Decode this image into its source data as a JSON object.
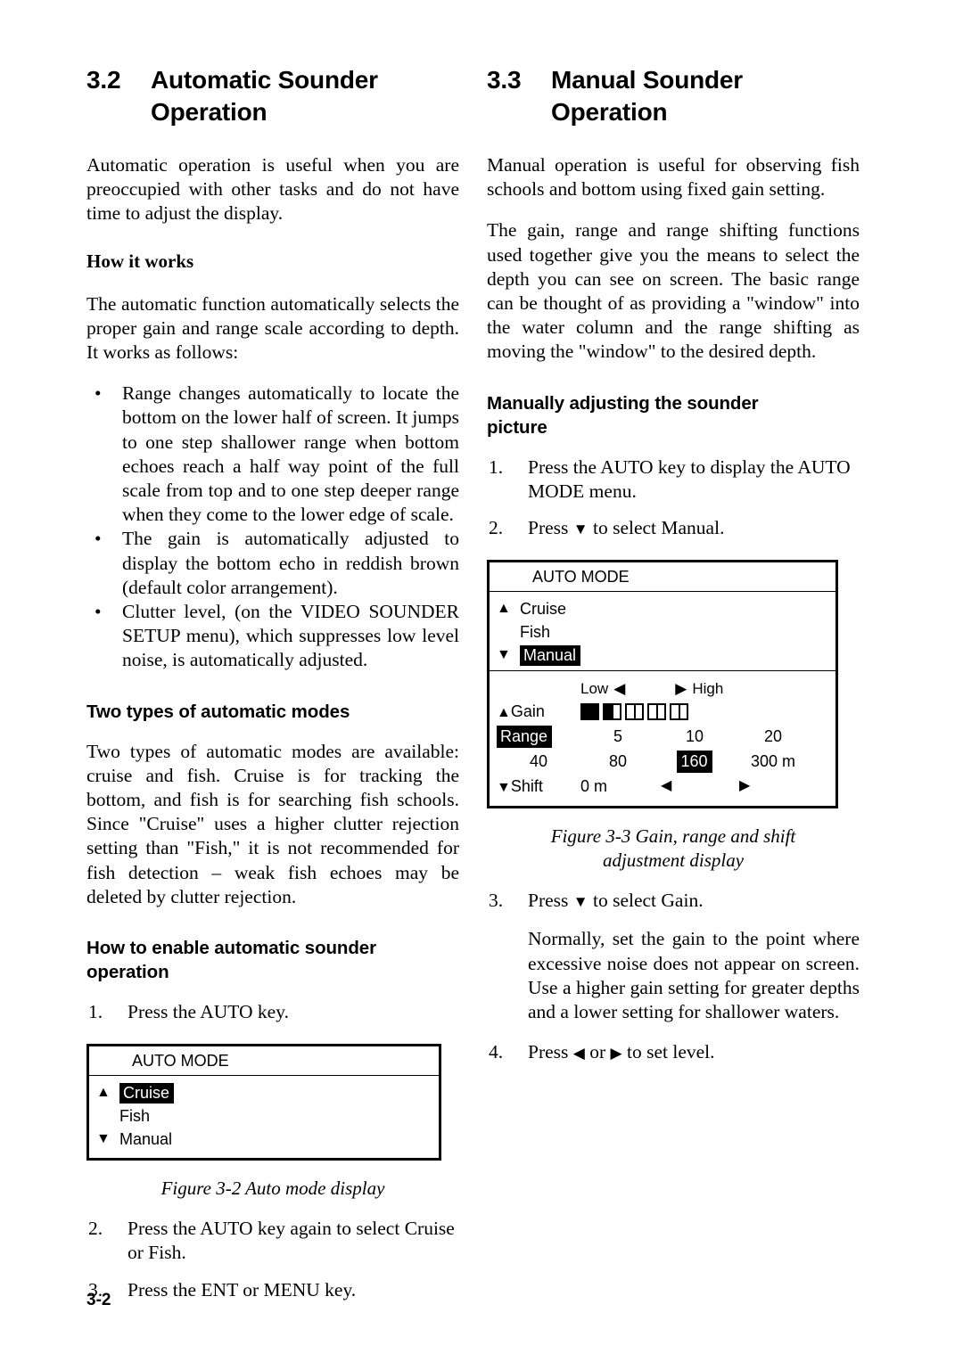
{
  "left_column": {
    "section": {
      "number": "3.2",
      "title_line1": "Automatic Sounder",
      "title_line2": "Operation"
    },
    "intro": "Automatic operation is useful when you are preoccupied with other tasks and do not have time to adjust the display.",
    "how_it_works_heading": "How it works",
    "how_it_works_intro": "The automatic function automatically selects the proper gain and range scale according to depth. It works as follows:",
    "bullets": [
      "Range changes automatically to locate the bottom on the lower half of screen. It jumps to one step shallower range when bottom echoes reach a half way point of the full scale from top and to one step deeper range when they come to the lower edge of scale.",
      "The gain is automatically adjusted to display the bottom echo in reddish brown (default color arrangement).",
      "Clutter level, (on the VIDEO SOUNDER SETUP menu), which suppresses low level noise, is automatically adjusted."
    ],
    "two_types_heading": "Two types of automatic modes",
    "two_types_body": "Two types of automatic modes are available: cruise and fish. Cruise is for tracking the bottom, and fish is for searching fish schools. Since \"Cruise\" uses a higher clutter rejection setting than \"Fish,\" it is not recommended for fish detection – weak fish echoes may be deleted by clutter rejection.",
    "enable_heading_line1": "How to enable automatic sounder",
    "enable_heading_line2": "operation",
    "step1": {
      "num": "1.",
      "text": "Press the AUTO key."
    },
    "figure_3_2": {
      "title": "AUTO MODE",
      "rows": [
        {
          "arrow": "▲",
          "label": "Cruise",
          "highlighted": true
        },
        {
          "arrow": "",
          "label": "Fish",
          "highlighted": false
        },
        {
          "arrow": "▼",
          "label": "Manual",
          "highlighted": false
        }
      ],
      "caption": "Figure 3-2 Auto mode display"
    },
    "steps_after": [
      {
        "num": "2.",
        "text": "Press the AUTO key again to select Cruise or Fish."
      },
      {
        "num": "3.",
        "text": "Press the ENT or MENU key."
      }
    ]
  },
  "right_column": {
    "section": {
      "number": "3.3",
      "title_line1": "Manual Sounder",
      "title_line2": "Operation"
    },
    "intro": "Manual operation is useful for observing fish schools and bottom using fixed gain setting.",
    "para2": "The gain, range and range shifting functions used together give you the means to select the depth you can see on screen. The basic range can be thought of as providing a \"window\" into the water column and the range shifting as moving the \"window\" to the desired depth.",
    "adjust_heading_line1": "Manually adjusting the sounder",
    "adjust_heading_line2": "picture",
    "steps_before": [
      {
        "num": "1.",
        "text": "Press the AUTO key to display the AUTO MODE menu."
      },
      {
        "num": "2.",
        "text_before": "Press ",
        "arrow": "▼",
        "text_after": " to select Manual."
      }
    ],
    "figure_3_3": {
      "title": "AUTO MODE",
      "mode_rows": [
        {
          "arrow": "▲",
          "label": "Cruise",
          "highlighted": false
        },
        {
          "arrow": "",
          "label": "Fish",
          "highlighted": false
        },
        {
          "arrow": "▼",
          "label": "Manual",
          "highlighted": true
        }
      ],
      "low_label": "Low",
      "low_arrow": "◀",
      "high_arrow": "▶",
      "high_label": "High",
      "gain_row": {
        "arrow": "▲",
        "label": "Gain",
        "segments": [
          "full",
          "half",
          "empty",
          "empty",
          "empty"
        ]
      },
      "range_row1": {
        "label": "Range",
        "label_highlighted": true,
        "values": [
          "5",
          "10",
          "20"
        ]
      },
      "range_row2": {
        "label": "40",
        "values": [
          "80",
          "160",
          "300 m"
        ],
        "selected_value": "160"
      },
      "shift_row": {
        "arrow": "▼",
        "label": "Shift",
        "value": "0 m",
        "left_arrow": "◀",
        "right_arrow": "▶"
      },
      "caption_line1": "Figure 3-3 Gain, range and shift",
      "caption_line2": "adjustment display"
    },
    "step3": {
      "num": "3.",
      "text_before": "Press ",
      "arrow": "▼",
      "text_after": " to select Gain."
    },
    "step3_note": "Normally, set the gain to the point where excessive noise does not appear on screen. Use a higher gain setting for greater depths and a lower setting for shallower waters.",
    "step4": {
      "num": "4.",
      "text_before": "Press ",
      "arrow_left": "◀",
      "text_mid": " or ",
      "arrow_right": "▶",
      "text_after": " to set level."
    }
  },
  "footer": {
    "page_number": "3-2"
  }
}
